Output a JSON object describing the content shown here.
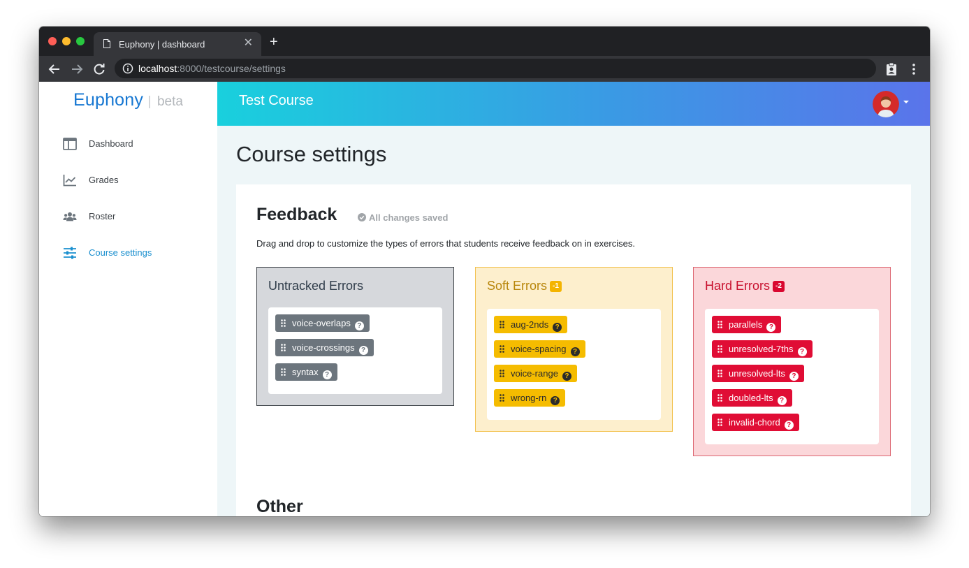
{
  "browser": {
    "tab_title": "Euphony | dashboard",
    "close_glyph": "✕",
    "new_tab_glyph": "+",
    "url_host": "localhost",
    "url_rest": ":8000/testcourse/settings"
  },
  "app": {
    "brand_name": "Euphony",
    "brand_sep": "|",
    "brand_sub": "beta",
    "header_title": "Test Course"
  },
  "sidebar": {
    "items": [
      {
        "label": "Dashboard",
        "icon": "dashboard-icon",
        "active": false
      },
      {
        "label": "Grades",
        "icon": "chart-line-icon",
        "active": false
      },
      {
        "label": "Roster",
        "icon": "users-icon",
        "active": false
      },
      {
        "label": "Course settings",
        "icon": "sliders-icon",
        "active": true
      }
    ]
  },
  "main": {
    "page_title": "Course settings",
    "feedback": {
      "title": "Feedback",
      "saved_status": "All changes saved",
      "description": "Drag and drop to customize the types of errors that students receive feedback on in exercises.",
      "buckets": [
        {
          "title": "Untracked Errors",
          "penalty": "",
          "chips": [
            "voice-overlaps",
            "voice-crossings",
            "syntax"
          ]
        },
        {
          "title": "Soft Errors",
          "penalty": "-1",
          "chips": [
            "aug-2nds",
            "voice-spacing",
            "voice-range",
            "wrong-rn"
          ]
        },
        {
          "title": "Hard Errors",
          "penalty": "-2",
          "chips": [
            "parallels",
            "unresolved-7ths",
            "unresolved-lts",
            "doubled-lts",
            "invalid-chord"
          ]
        }
      ]
    },
    "other_title": "Other"
  },
  "colors": {
    "brand": "#1677d2",
    "active_nav": "#1a8fcf",
    "untracked_chip": "#6c757d",
    "soft_chip": "#f5bc00",
    "hard_chip": "#e00d35"
  }
}
